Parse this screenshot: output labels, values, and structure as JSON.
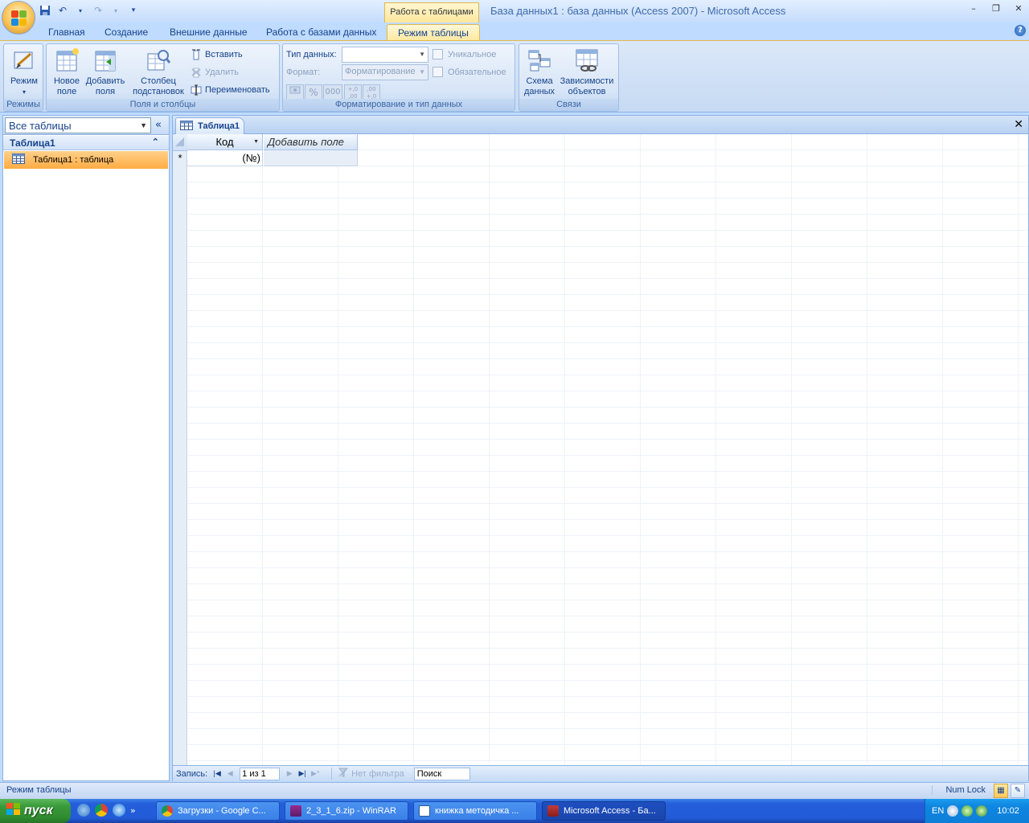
{
  "window": {
    "title": "База данных1 : база данных (Access 2007) - Microsoft Access",
    "context_tab_title": "Работа с таблицами",
    "controls": [
      "–",
      "❐",
      "✕"
    ]
  },
  "ribbon_tabs": [
    "Главная",
    "Создание",
    "Внешние данные",
    "Работа с базами данных",
    "Режим таблицы"
  ],
  "ribbon_active_tab": "Режим таблицы",
  "groups": {
    "modes": {
      "label": "Режимы",
      "view_button": "Режим"
    },
    "fields": {
      "label": "Поля и столбцы",
      "new_field_line1": "Новое",
      "new_field_line2": "поле",
      "add_fields_line1": "Добавить",
      "add_fields_line2": "поля",
      "lookup_line1": "Столбец",
      "lookup_line2": "подстановок",
      "insert": "Вставить",
      "delete": "Удалить",
      "rename": "Переименовать"
    },
    "formatting": {
      "label": "Форматирование и тип данных",
      "data_type_label": "Тип данных:",
      "data_type_value": "",
      "format_label": "Формат:",
      "format_value": "Форматирование",
      "unique": "Уникальное",
      "required": "Обязательное",
      "percent": "%",
      "thousands": "000",
      "increase_decimals": "+,0 ,00",
      "decrease_decimals": ",00 +,0"
    },
    "relationships": {
      "label": "Связи",
      "schema_line1": "Схема",
      "schema_line2": "данных",
      "deps_line1": "Зависимости",
      "deps_line2": "объектов"
    }
  },
  "nav_pane": {
    "title": "Все таблицы",
    "collapse_glyph": "«",
    "group": "Таблица1",
    "items": [
      {
        "label": "Таблица1 : таблица"
      }
    ]
  },
  "document": {
    "tab": "Таблица1",
    "columns": [
      "Код",
      "Добавить поле"
    ],
    "new_row_marker": "*",
    "new_row_kod": "(№)"
  },
  "record_nav": {
    "label": "Запись:",
    "position": "1 из 1",
    "filter": "Нет фильтра",
    "search": "Поиск"
  },
  "status": {
    "left": "Режим таблицы",
    "numlock": "Num Lock"
  },
  "taskbar": {
    "start": "пуск",
    "tasks": [
      "Загрузки - Google C...",
      "2_3_1_6.zip - WinRAR",
      "книжка методичка ...",
      "Microsoft Access - Ба..."
    ],
    "lang": "EN",
    "clock": "10:02"
  },
  "colors": {
    "accent": "#15428b",
    "selected_item": "#ffac43",
    "taskbar": "#245edc",
    "start": "#3a9a3a"
  }
}
